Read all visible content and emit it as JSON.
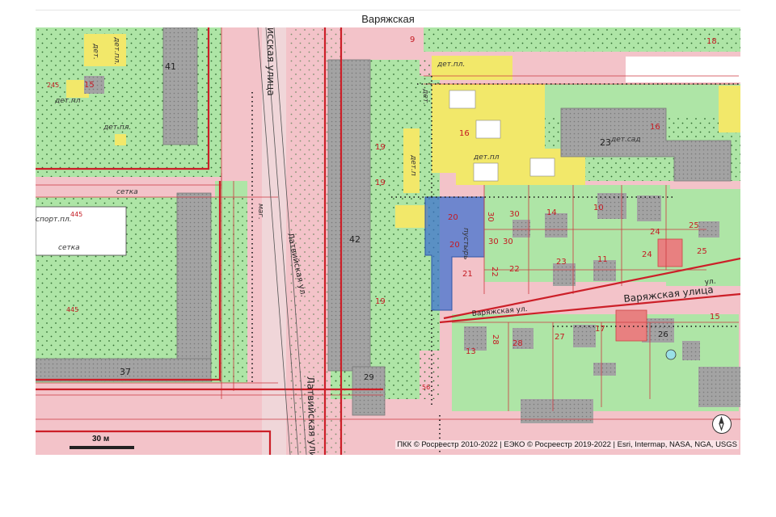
{
  "title": "Варяжская",
  "scale": {
    "label": "30 м"
  },
  "attribution": "ПКК © Росреестр 2010-2022 | ЕЭКО © Росреестр 2019-2022 | Esri, Intermap, NASA, NGA, USGS",
  "compass": {
    "icon": "compass-icon"
  },
  "colors": {
    "background_pink": "#f3c3c9",
    "green": "#aee5a6",
    "yellow": "#f2e86a",
    "building": "#a8a8a8",
    "boundary_red": "#cc1f28",
    "highlight_blue": "#3a6fd0"
  },
  "streets": {
    "latv_top": "исская улица",
    "latv_small": "Латвийская ул.",
    "latv_bottom": "Латвийская улица",
    "varyazh_big": "Варяжская улица",
    "varyazh_ul_small": "ул.",
    "varyazh_small": "Варяжская ул."
  },
  "areas": {
    "setka": "сетка",
    "sport": "спорт.пл.",
    "setka2": "сетка",
    "det_pl_1": "дет.",
    "det_pl_2": "дет.пл.",
    "det_pl_3": "дет.пл.",
    "det_pl_4": "дет.пл",
    "det_pl_5": "дет.пл.",
    "det_pl_6": "дет.пл",
    "det_pl_7": "дет.",
    "det_pl_8": "дет.п",
    "det_sad": "дет.сад",
    "pustyr": "пустырь",
    "mag": "маг."
  },
  "labels": {
    "n41": "41",
    "n42": "42",
    "n37": "37",
    "n29": "29",
    "n15a": "15",
    "n245": "245",
    "n445a": "445",
    "n445b": "445",
    "n9": "9",
    "n18": "18",
    "n16a": "16",
    "n16b": "16",
    "n23a": "23",
    "n19a": "19",
    "n19b": "19",
    "n19c": "19",
    "n20a": "20",
    "n20b": "20",
    "n30a": "30",
    "n30b": "30",
    "n30c": "30",
    "n30d": "30",
    "n14": "14",
    "n10": "10",
    "n25a": "25",
    "n25b": "25",
    "n24a": "24",
    "n24b": "24",
    "n21": "21",
    "n22a": "22",
    "n22b": "22",
    "n23b": "23",
    "n11": "11",
    "n13": "13",
    "n28a": "28",
    "n28b": "28",
    "n27": "27",
    "n17": "17",
    "n26": "26",
    "n15b": "15",
    "n56": "56"
  }
}
